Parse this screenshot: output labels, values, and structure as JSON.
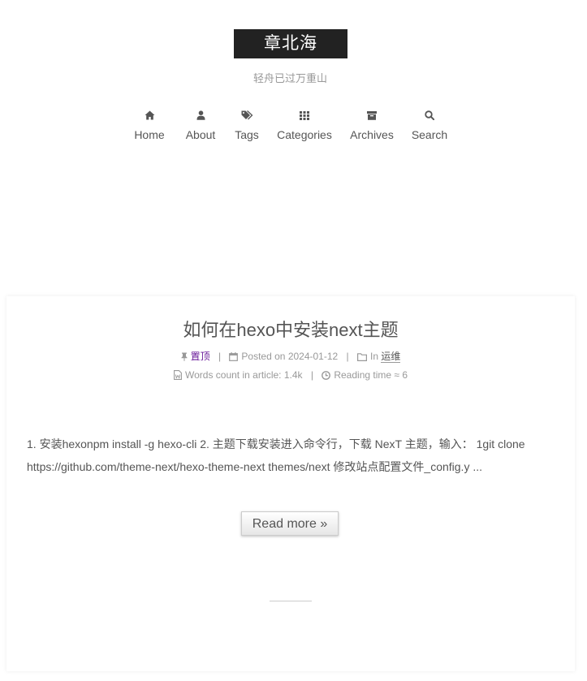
{
  "header": {
    "site_title": "章北海",
    "subtitle": "轻舟已过万重山"
  },
  "nav": [
    {
      "label": "Home",
      "icon": "home-icon"
    },
    {
      "label": "About",
      "icon": "user-icon"
    },
    {
      "label": "Tags",
      "icon": "tags-icon"
    },
    {
      "label": "Categories",
      "icon": "th-icon"
    },
    {
      "label": "Archives",
      "icon": "archive-icon"
    },
    {
      "label": "Search",
      "icon": "search-icon"
    }
  ],
  "post": {
    "title": "如何在hexo中安装next主题",
    "pinned_label": "置顶",
    "posted_label": "Posted on",
    "date": "2024-01-12",
    "in_label": "In",
    "category": "运维",
    "words_label": "Words count in article:",
    "words_value": "1.4k",
    "reading_label": "Reading time ≈",
    "reading_value": "6",
    "excerpt": "1. 安装hexonpm install -g hexo-cli 2. 主题下载安装进入命令行，下载 NexT 主题，输入： 1git clone https://github.com/theme-next/hexo-theme-next themes/next 修改站点配置文件_config.y ...",
    "read_more": "Read more »"
  },
  "colors": {
    "brand_bg": "#222222",
    "text": "#555555",
    "muted": "#999999",
    "pin_link": "#6a1b9a"
  }
}
